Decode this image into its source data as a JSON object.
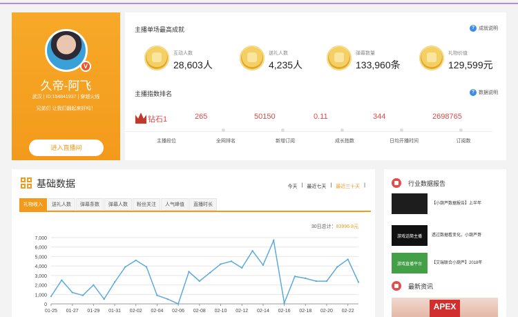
{
  "profile": {
    "name": "久帝-阿飞",
    "id_line": "武汉 | ID:154841937 | 穿越火线",
    "message": "兄弟们 让我们翻起来好吗！",
    "badge": "V",
    "enter_button": "进入直播间"
  },
  "achievements": {
    "title": "主播单场最高成就",
    "help": "成就说明",
    "stats": [
      {
        "label": "互动人数",
        "value": "28,603人",
        "icon": "medal-icon"
      },
      {
        "label": "送礼人数",
        "value": "4,235人",
        "icon": "medal-icon"
      },
      {
        "label": "弹幕数量",
        "value": "133,960条",
        "icon": "medal-icon"
      },
      {
        "label": "礼物价值",
        "value": "129,599元",
        "icon": "medal-icon"
      }
    ]
  },
  "rankings": {
    "title": "主播指数排名",
    "help": "数据说明",
    "items": [
      {
        "value": "钻石1",
        "label": "主播段位"
      },
      {
        "value": "265",
        "label": "全网排名"
      },
      {
        "value": "50150",
        "label": "新增订阅"
      },
      {
        "value": "0.11",
        "label": "成长指数"
      },
      {
        "value": "344",
        "label": "日均开播时间"
      },
      {
        "value": "2698765",
        "label": "订阅数"
      }
    ]
  },
  "basic": {
    "title": "基础数据",
    "ranges": [
      "今天",
      "最近七天",
      "最近三十天"
    ],
    "selected_range": 2,
    "tabs": [
      "礼物收入",
      "送礼人数",
      "弹幕条数",
      "弹幕人数",
      "粉丝关注",
      "人气峰值",
      "直播时长"
    ],
    "active_tab": 0,
    "total_label": "30日总计：",
    "total_value": "83996.8元"
  },
  "chart_data": {
    "type": "line",
    "x": [
      "01-25",
      "01-26",
      "01-27",
      "01-28",
      "01-29",
      "01-30",
      "01-31",
      "02-01",
      "02-02",
      "02-03",
      "02-04",
      "02-05",
      "02-06",
      "02-07",
      "02-08",
      "02-09",
      "02-10",
      "02-11",
      "02-12",
      "02-13",
      "02-14",
      "02-15",
      "02-16",
      "02-17",
      "02-18",
      "02-19",
      "02-20",
      "02-21",
      "02-22",
      "02-23"
    ],
    "x_tick_labels": [
      "01-25",
      "01-27",
      "01-29",
      "01-31",
      "02-02",
      "02-04",
      "02-06",
      "02-08",
      "02-10",
      "02-12",
      "02-14",
      "02-16",
      "02-18",
      "02-20",
      "02-22"
    ],
    "y": [
      800,
      2500,
      1200,
      900,
      2000,
      500,
      2300,
      3900,
      4600,
      3900,
      900,
      500,
      0,
      3400,
      2400,
      3300,
      4200,
      4500,
      3800,
      5600,
      4100,
      6700,
      100,
      2900,
      2700,
      2400,
      2400,
      3900,
      4700,
      2300
    ],
    "ylim": [
      0,
      7000
    ],
    "yticks": [
      "0",
      "1,000",
      "2,000",
      "3,000",
      "4,000",
      "5,000",
      "6,000",
      "7,000"
    ],
    "color": "#5aa9dd",
    "grid": true
  },
  "side": {
    "reports_title": "行业数据报告",
    "reports": [
      {
        "thumb_text": "",
        "title": "【小葫芦数据报告】上半年",
        "thumb_color": "#1d1d1d"
      },
      {
        "thumb_text": "游戏话筒主播",
        "title": "透过数据看变化，小葫芦哥",
        "thumb_color": "#111111"
      },
      {
        "thumb_text": "游戏直播平台",
        "title": "【艾瑞联合小葫芦】2018年",
        "thumb_color": "#43a047"
      }
    ],
    "news_title": "最新资讯",
    "news_badge": "APEX"
  }
}
